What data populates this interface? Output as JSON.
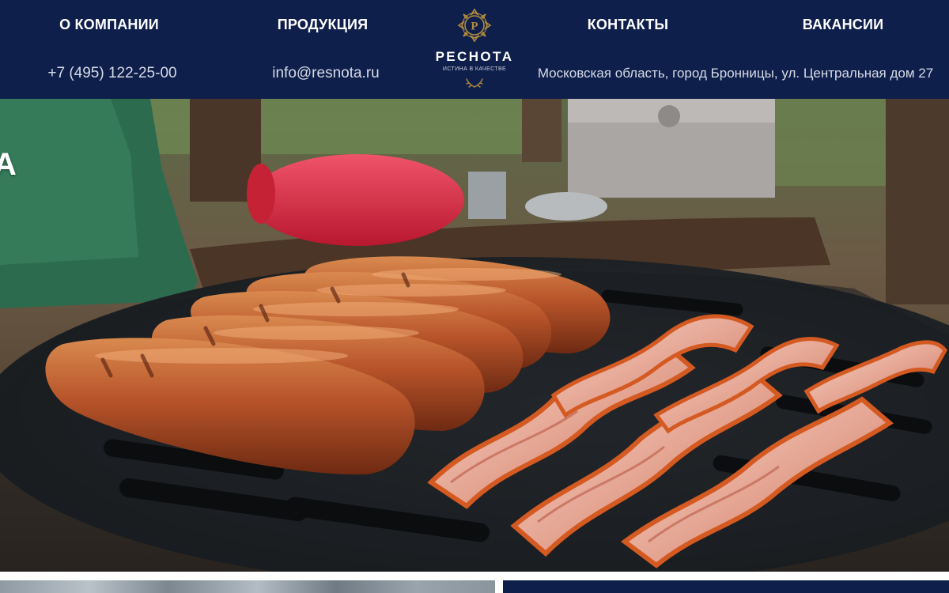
{
  "nav": {
    "about": "О КОМПАНИИ",
    "products": "ПРОДУКЦИЯ",
    "contacts": "КОНТАКТЫ",
    "jobs": "ВАКАНСИИ"
  },
  "contacts": {
    "phone": "+7 (495) 122-25-00",
    "email": "info@resnota.ru",
    "address": "Московская область, город Бронницы, ул. Центральная дом 27"
  },
  "logo": {
    "name": "РЕСНОТА",
    "tagline": "ИСТИНА В КАЧЕСТВЕ",
    "emblem_letter": "Р",
    "emblem_icon": "ornate-r-emblem-icon"
  },
  "hero": {
    "edge_text": "А",
    "image": "grilled-sausages-and-bacon-photo"
  },
  "colors": {
    "header_bg": "#0f1f4b",
    "logo_gold": "#b08a3e",
    "header_text": "#ffffff",
    "contact_text": "#d7dbe6"
  }
}
